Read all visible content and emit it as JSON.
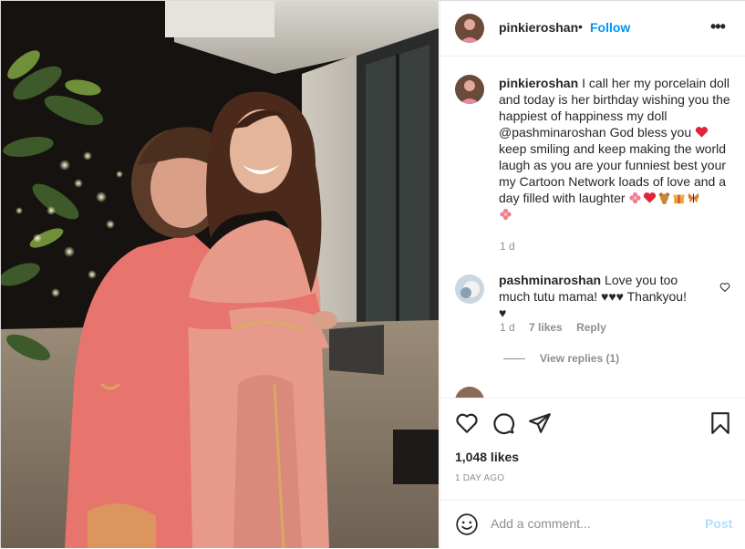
{
  "post": {
    "username": "pinkieroshan",
    "dot": "•",
    "follow_label": "Follow",
    "more_label": "•••"
  },
  "caption": {
    "username": "pinkieroshan",
    "text": "I call her my porcelain doll and today is her birthday wishing you the happiest of happiness my doll @pashminaroshan God bless you",
    "text2": "keep smiling and keep making the world laugh as you are your funniest best your my Cartoon Network loads of love and a day filled with laughter",
    "time": "1 d"
  },
  "comment": {
    "username": "pashminaroshan",
    "text": "Love you too much tutu mama! ♥♥♥ Thankyou! ♥",
    "time": "1 d",
    "likes": "7 likes",
    "reply_label": "Reply",
    "view_replies": "View replies (1)"
  },
  "next_comment_partial": "",
  "footer": {
    "likes": "1,048 likes",
    "ago": "1 DAY AGO",
    "add_comment_placeholder": "Add a comment...",
    "post_label": "Post"
  },
  "icons": [
    "heart-icon",
    "comment-icon",
    "share-icon",
    "bookmark-icon",
    "emoji-icon",
    "small-heart-icon"
  ],
  "colors": {
    "link": "#0095f6",
    "post_disabled": "#b2dffc",
    "heart_red": "#ed4956",
    "muted": "#8e8e8e"
  }
}
